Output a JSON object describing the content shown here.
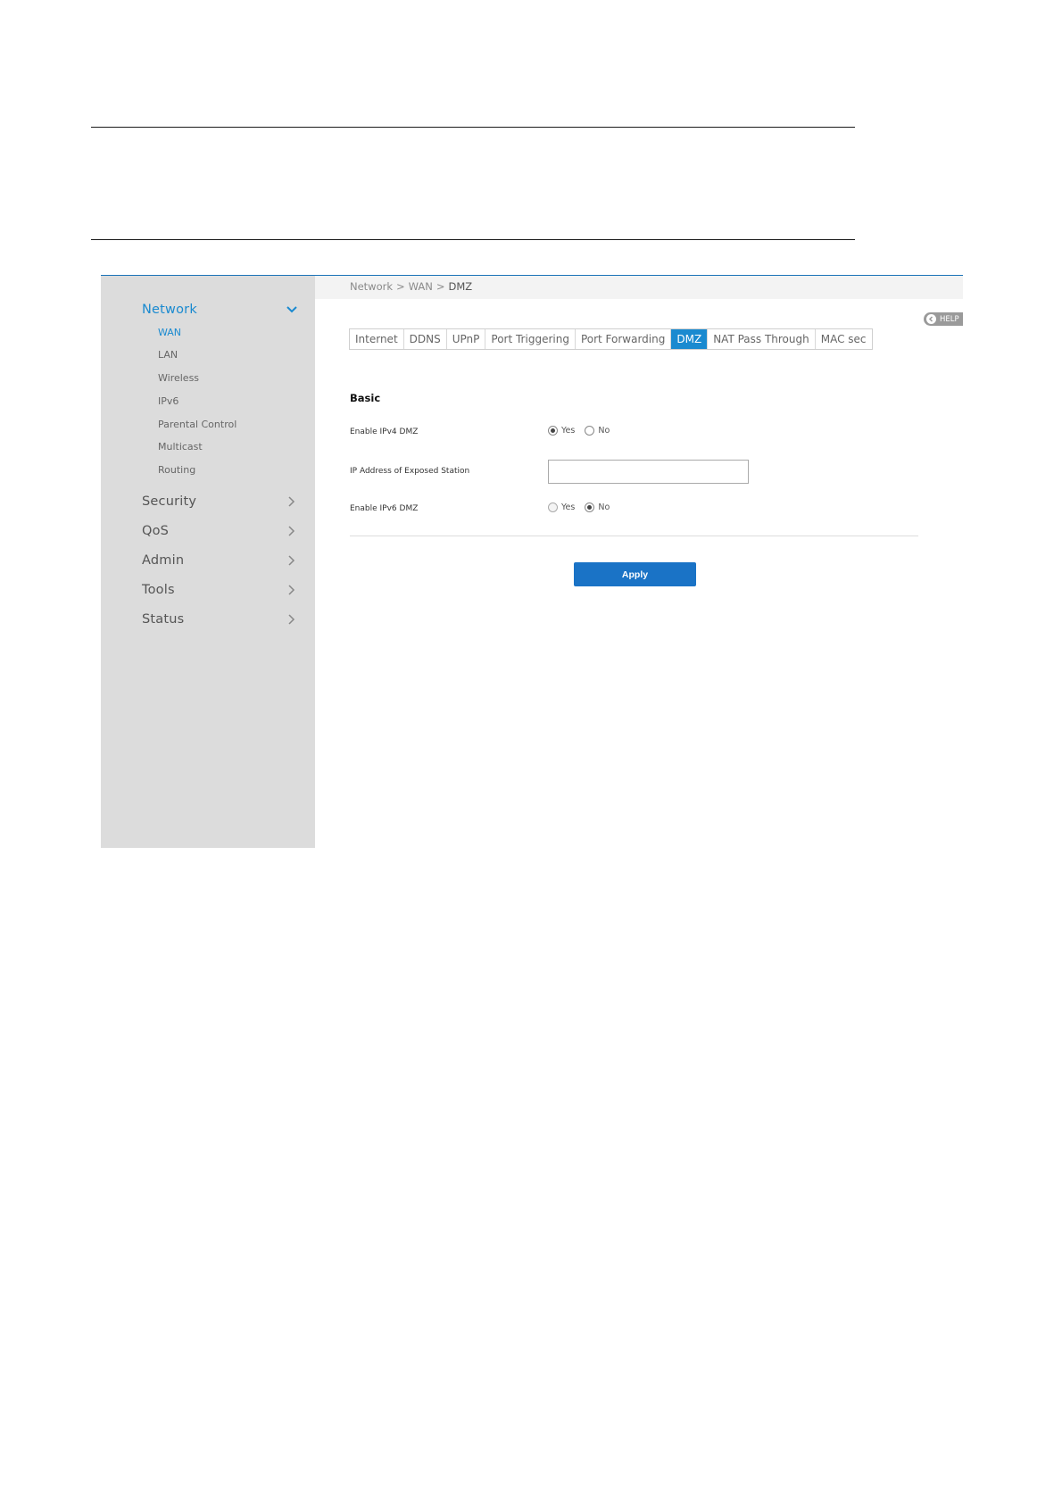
{
  "breadcrumb": {
    "level1": "Network",
    "level2": "WAN",
    "current": "DMZ",
    "separator": ">"
  },
  "help": {
    "label": "HELP"
  },
  "sidebar": {
    "network": {
      "label": "Network",
      "items": [
        "WAN",
        "LAN",
        "Wireless",
        "IPv6",
        "Parental Control",
        "Multicast",
        "Routing"
      ]
    },
    "groups": [
      "Security",
      "QoS",
      "Admin",
      "Tools",
      "Status"
    ]
  },
  "tabs": [
    "Internet",
    "DDNS",
    "UPnP",
    "Port Triggering",
    "Port Forwarding",
    "DMZ",
    "NAT Pass Through",
    "MAC sec"
  ],
  "form": {
    "section_title": "Basic",
    "ipv4_label": "Enable IPv4 DMZ",
    "ip_label": "IP Address of Exposed Station",
    "ip_value": "",
    "ipv6_label": "Enable IPv6 DMZ",
    "yes_label": "Yes",
    "no_label": "No",
    "ipv4_selected": "Yes",
    "ipv6_selected": "No",
    "apply_label": "Apply"
  },
  "colors": {
    "accent": "#1a8ad0",
    "apply": "#1a73c6",
    "sidebar_bg": "#dcdcdc"
  }
}
